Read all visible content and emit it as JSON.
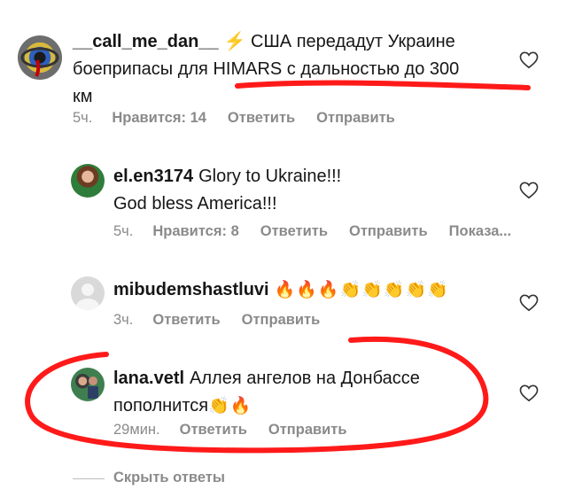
{
  "comments": [
    {
      "username": "__call_me_dan__",
      "lead_emoji": "⚡",
      "text": "США передадут Украине боепрупасы для HIMARS с дальностью до 300 км",
      "line1": "США передадут Украине",
      "line2": "боеприпасы для HIMARS с дальностью до 300",
      "line3": "км",
      "time": "5ч.",
      "likes": "Нравится: 14",
      "reply": "Ответить",
      "send": "Отправить"
    },
    {
      "username": "el.en3174",
      "line1": "Glory to Ukraine!!!",
      "line2": "God bless America!!!",
      "time": "5ч.",
      "likes": "Нравится: 8",
      "reply": "Ответить",
      "send": "Отправить",
      "show": "Показа..."
    },
    {
      "username": "mibudemshastluvi",
      "emojis": "🔥🔥🔥👏👏👏👏👏",
      "time": "3ч.",
      "reply": "Ответить",
      "send": "Отправить"
    },
    {
      "username": "lana.vetl",
      "line1": "Аллея ангелов на Донбассе",
      "line2": "пополнится",
      "emojis": "👏🔥",
      "time": "29мин.",
      "reply": "Ответить",
      "send": "Отправить"
    }
  ],
  "hide_replies": "Скрыть ответы",
  "colors": {
    "annotation": "#ff1a1a",
    "meta": "#8a8a8a",
    "text": "#161616"
  },
  "icons": [
    "heart-icon",
    "avatar"
  ]
}
